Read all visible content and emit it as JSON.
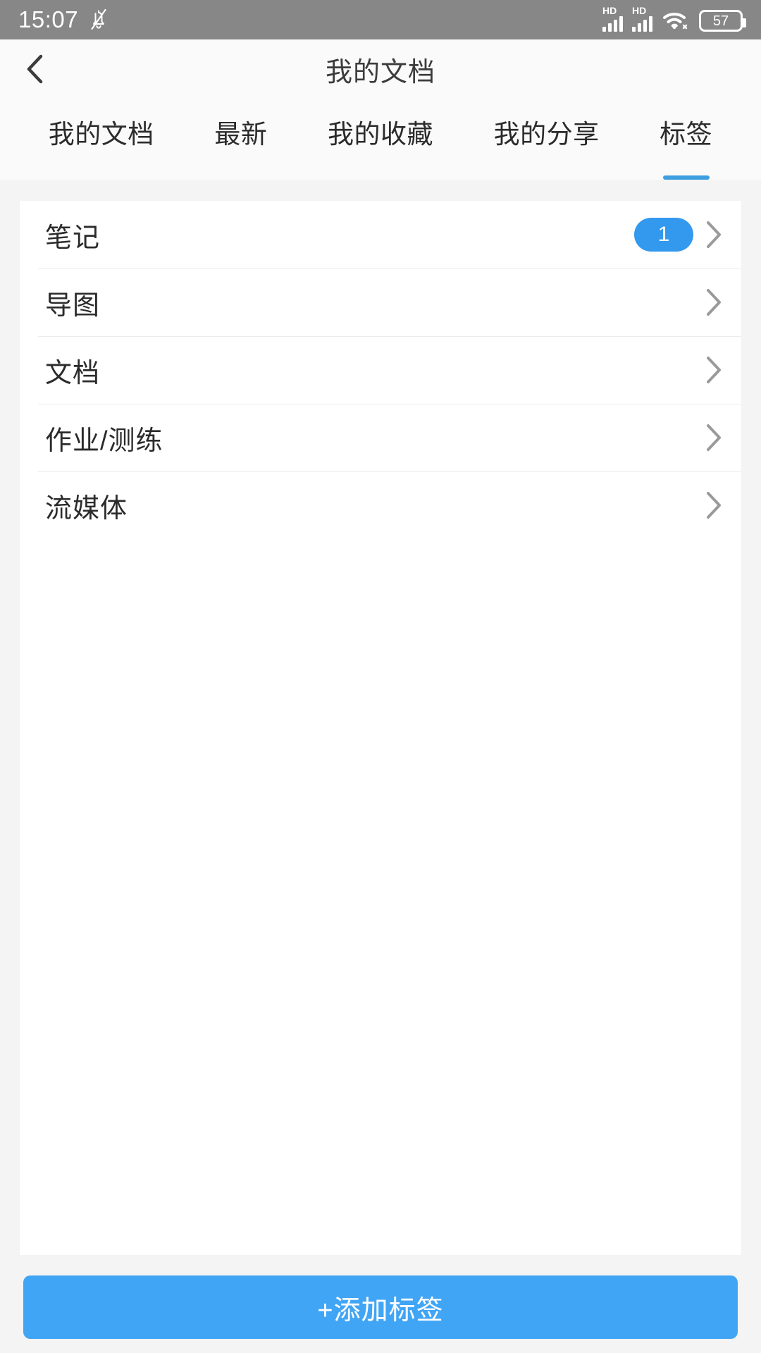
{
  "status_bar": {
    "time": "15:07",
    "mute_icon": "bell-mute-icon",
    "signal_1": {
      "icon": "signal-bars-icon",
      "label": "HD"
    },
    "signal_2": {
      "icon": "signal-bars-icon",
      "label": "HD"
    },
    "wifi_icon": "wifi-icon",
    "battery_level": "57"
  },
  "header": {
    "back_icon": "back-chevron-icon",
    "title": "我的文档"
  },
  "tabs": [
    {
      "label": "我的文档",
      "active": false
    },
    {
      "label": "最新",
      "active": false
    },
    {
      "label": "我的收藏",
      "active": false
    },
    {
      "label": "我的分享",
      "active": false
    },
    {
      "label": "标签",
      "active": true
    }
  ],
  "list": [
    {
      "label": "笔记",
      "badge": "1",
      "chevron": "chevron-right-icon"
    },
    {
      "label": "导图",
      "badge": "",
      "chevron": "chevron-right-icon"
    },
    {
      "label": "文档",
      "badge": "",
      "chevron": "chevron-right-icon"
    },
    {
      "label": "作业/测练",
      "badge": "",
      "chevron": "chevron-right-icon"
    },
    {
      "label": "流媒体",
      "badge": "",
      "chevron": "chevron-right-icon"
    }
  ],
  "footer": {
    "add_label": "+添加标签"
  },
  "colors": {
    "accent": "#41a5f5",
    "badge": "#3399ee",
    "tab_underline": "#3d9ee0",
    "status_bar": "#878787",
    "page_bg": "#f4f4f4",
    "card_bg": "#ffffff"
  }
}
